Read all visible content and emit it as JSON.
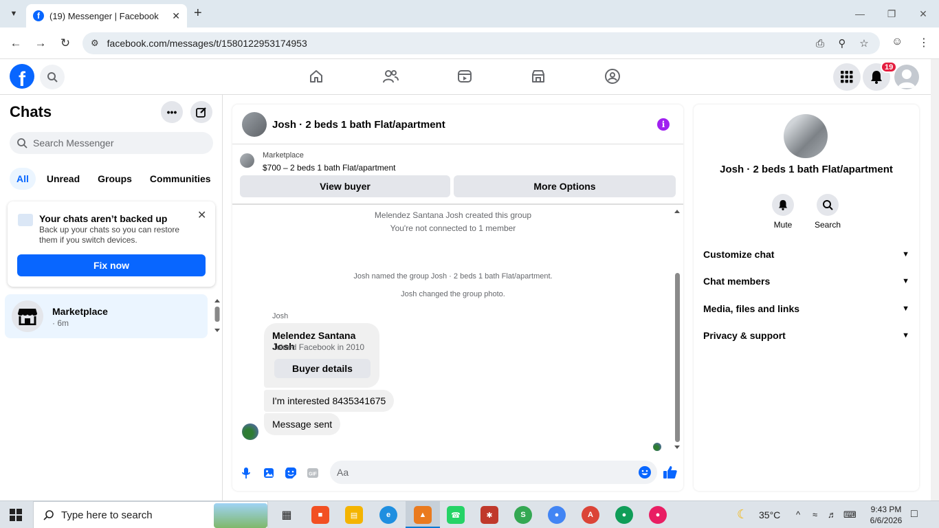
{
  "browser": {
    "tab_title": "(19) Messenger | Facebook",
    "url": "facebook.com/messages/t/1580122953174953"
  },
  "fbnav": {
    "notification_count": "19"
  },
  "sidebar": {
    "title": "Chats",
    "search_placeholder": "Search Messenger",
    "filters": [
      "All",
      "Unread",
      "Groups",
      "Communities"
    ],
    "backup": {
      "title": "Your chats aren’t backed up",
      "text": "Back up your chats so you can restore them if you switch devices.",
      "button": "Fix now"
    },
    "chats": [
      {
        "name": "Marketplace",
        "time": "· 6m"
      }
    ]
  },
  "conversation": {
    "title": "Josh · 2 beds 1 bath Flat/apartment",
    "marketplace_label": "Marketplace",
    "listing": "$700 – 2 beds 1 bath Flat/apartment",
    "view_buyer": "View buyer",
    "more_options": "More Options",
    "system": [
      "Melendez Santana Josh created this group",
      "You're not connected to 1 member",
      "Josh named the group Josh · 2 beds 1 bath Flat/apartment.",
      "Josh changed the group photo."
    ],
    "sender": "Josh",
    "card": {
      "name": "Melendez Santana Josh",
      "joined": "Joined Facebook in 2010",
      "button": "Buyer details"
    },
    "messages": [
      "I'm interested 8435341675",
      "Message sent"
    ],
    "composer_placeholder": "Aa"
  },
  "right_panel": {
    "name": "Josh · 2 beds 1 bath Flat/apartment",
    "actions": [
      "Mute",
      "Search"
    ],
    "sections": [
      "Customize chat",
      "Chat members",
      "Media, files and links",
      "Privacy & support"
    ]
  },
  "taskbar": {
    "search_placeholder": "Type here to search",
    "weather": "35°C",
    "time": "9:43 PM",
    "date": "6/6/2026"
  },
  "colors": {
    "accent": "#0866ff",
    "info": "#a020f0",
    "badge": "#e41e3f"
  }
}
